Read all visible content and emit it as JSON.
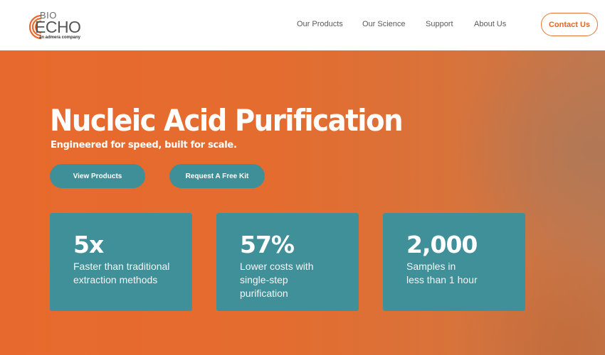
{
  "header": {
    "logo": {
      "bio": "BIO",
      "echo": "ECHO",
      "sub": "an admera company"
    },
    "nav": [
      {
        "label": "Our Products"
      },
      {
        "label": "Our Science"
      },
      {
        "label": "Support"
      },
      {
        "label": "About Us"
      }
    ],
    "contact_label": "Contact Us"
  },
  "hero": {
    "title": "Nucleic Acid Purification",
    "subtitle": "Engineered for speed, built for scale.",
    "buttons": {
      "view_products": "View Products",
      "request_kit": "Request A Free Kit"
    },
    "stats": [
      {
        "value": "5x",
        "description": "Faster than traditional\nextraction methods"
      },
      {
        "value": "57%",
        "description": "Lower costs with\nsingle-step\npurification"
      },
      {
        "value": "2,000",
        "description": "Samples in\nless than 1 hour"
      }
    ]
  },
  "colors": {
    "brand_orange": "#e8692d",
    "accent_teal": "#3f9099",
    "contact_border": "#e8752f"
  }
}
